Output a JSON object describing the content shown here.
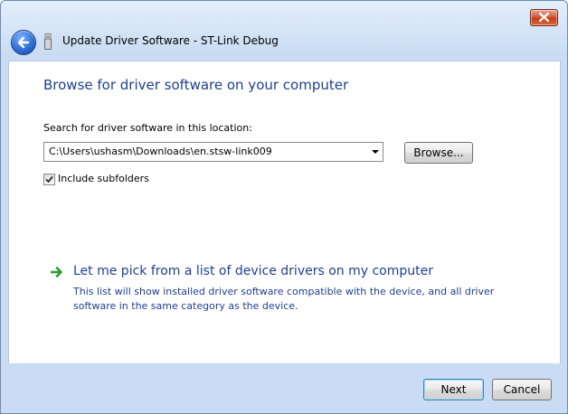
{
  "window": {
    "title": "Update Driver Software - ST-Link Debug"
  },
  "content": {
    "heading": "Browse for driver software on your computer",
    "search_label": "Search for driver software in this location:",
    "path_value": "C:\\Users\\ushasm\\Downloads\\en.stsw-link009",
    "browse_label": "Browse...",
    "include_subfolders_label": "Include subfolders",
    "include_subfolders_checked": true,
    "pick_link": "Let me pick from a list of device drivers on my computer",
    "pick_description": "This list will show installed driver software compatible with the device, and all driver software in the same category as the device."
  },
  "footer": {
    "next_label": "Next",
    "cancel_label": "Cancel"
  },
  "colors": {
    "heading_blue": "#1e3f8f",
    "link_green_arrow": "#2e9a2e",
    "close_red": "#c63a17"
  },
  "icons": [
    "close-icon",
    "back-arrow-icon",
    "device-icon",
    "checkmark-icon",
    "green-arrow-icon",
    "dropdown-arrow-icon"
  ]
}
